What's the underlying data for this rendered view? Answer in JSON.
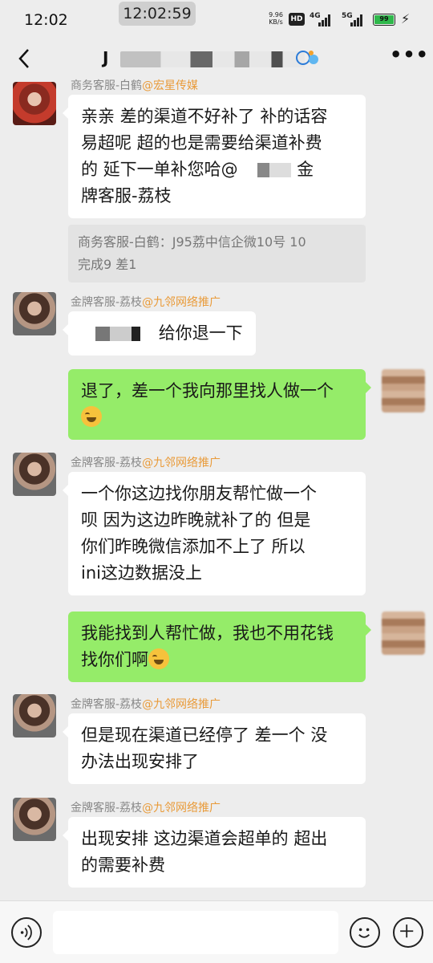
{
  "status_bar": {
    "time": "12:02",
    "clock_pill": "12:02:59",
    "net_speed": "9.96",
    "net_speed_unit": "KB/s",
    "hd_badge": "HD",
    "network_1": "4G",
    "network_2": "5G",
    "battery": "99"
  },
  "nav": {
    "title_visible": "J",
    "more_label": "•••"
  },
  "messages": [
    {
      "sender_name": "商务客服-白鹤",
      "sender_org": "@宏星传媒",
      "text_lines": [
        "亲亲  差的渠道不好补了  补的话容",
        "易超呢   超的也是需要给渠道补费",
        "的  延下一单补您哈@",
        "牌客服-荔枝"
      ],
      "line3_tail": "金",
      "quote_lines": [
        "商务客服-白鹤：J95荔中信企微10号  10",
        "完成9  差1"
      ]
    },
    {
      "sender_name": "金牌客服-荔枝",
      "sender_org": "@九邻网络推广",
      "text": "给你退一下"
    },
    {
      "text": "退了，差一个我向那里找人做一个"
    },
    {
      "sender_name": "金牌客服-荔枝",
      "sender_org": "@九邻网络推广",
      "text_lines": [
        "一个你这边找你朋友帮忙做一个",
        "呗  因为这边昨晚就补了的    但是",
        "你们昨晚微信添加不上了     所以",
        "ini这边数据没上"
      ]
    },
    {
      "text_lines": [
        "我能找到人帮忙做，我也不用花钱",
        "找你们啊"
      ]
    },
    {
      "sender_name": "金牌客服-荔枝",
      "sender_org": "@九邻网络推广",
      "text_lines": [
        "但是现在渠道已经停了 差一个  没",
        "办法出现安排了"
      ]
    },
    {
      "sender_name": "金牌客服-荔枝",
      "sender_org": "@九邻网络推广",
      "text_lines": [
        "出现安排 这边渠道会超单的    超出",
        "的需要补费"
      ]
    }
  ],
  "input_bar": {
    "placeholder": ""
  }
}
